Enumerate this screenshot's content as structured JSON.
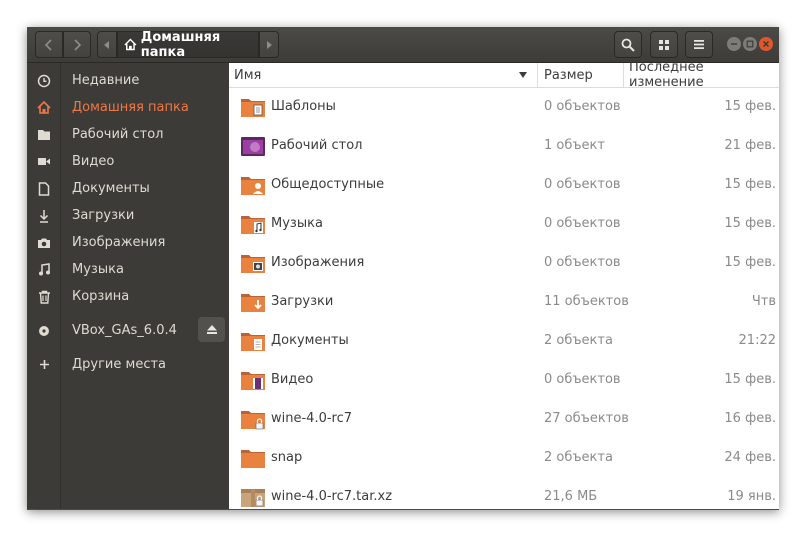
{
  "header": {
    "back_icon": "chevron-left-icon",
    "forward_icon": "chevron-right-icon",
    "path_label": "Домашняя папка",
    "path_icon": "home-icon"
  },
  "colors": {
    "accent": "#f07746",
    "sidebar_bg": "#3c3b37",
    "header_bg": "#3d3c38",
    "folder": "#e9823e",
    "close_button": "#e0582a"
  },
  "sidebar": {
    "items": [
      {
        "label": "Недавние",
        "icon": "clock-icon"
      },
      {
        "label": "Домашняя папка",
        "icon": "home-icon",
        "active": true
      },
      {
        "label": "Рабочий стол",
        "icon": "folder-icon"
      },
      {
        "label": "Видео",
        "icon": "video-icon"
      },
      {
        "label": "Документы",
        "icon": "document-icon"
      },
      {
        "label": "Загрузки",
        "icon": "download-icon"
      },
      {
        "label": "Изображения",
        "icon": "camera-icon"
      },
      {
        "label": "Музыка",
        "icon": "music-icon"
      },
      {
        "label": "Корзина",
        "icon": "trash-icon"
      },
      {
        "label": "VBox_GAs_6.0.4",
        "icon": "disc-icon"
      },
      {
        "label": "Другие места",
        "icon": "plus-icon"
      }
    ]
  },
  "columns": {
    "name": "Имя",
    "size": "Размер",
    "modified": "Последнее изменение"
  },
  "files": [
    {
      "name": "Шаблоны",
      "size": "0 объектов",
      "modified": "15 фев.",
      "icon": "templates-folder-icon"
    },
    {
      "name": "Рабочий стол",
      "size": "1 объект",
      "modified": "21 фев.",
      "icon": "desktop-folder-icon"
    },
    {
      "name": "Общедоступные",
      "size": "0 объектов",
      "modified": "15 фев.",
      "icon": "public-folder-icon"
    },
    {
      "name": "Музыка",
      "size": "0 объектов",
      "modified": "15 фев.",
      "icon": "music-folder-icon"
    },
    {
      "name": "Изображения",
      "size": "0 объектов",
      "modified": "15 фев.",
      "icon": "pictures-folder-icon"
    },
    {
      "name": "Загрузки",
      "size": "11 объектов",
      "modified": "Чтв",
      "icon": "downloads-folder-icon"
    },
    {
      "name": "Документы",
      "size": "2 объекта",
      "modified": "21:22",
      "icon": "documents-folder-icon"
    },
    {
      "name": "Видео",
      "size": "0 объектов",
      "modified": "15 фев.",
      "icon": "videos-folder-icon"
    },
    {
      "name": "wine-4.0-rc7",
      "size": "27 объектов",
      "modified": "16 фев.",
      "icon": "locked-folder-icon"
    },
    {
      "name": "snap",
      "size": "2 объекта",
      "modified": "24 фев.",
      "icon": "folder-icon"
    },
    {
      "name": "wine-4.0-rc7.tar.xz",
      "size": "21,6 МБ",
      "modified": "19 янв.",
      "icon": "archive-icon"
    }
  ]
}
